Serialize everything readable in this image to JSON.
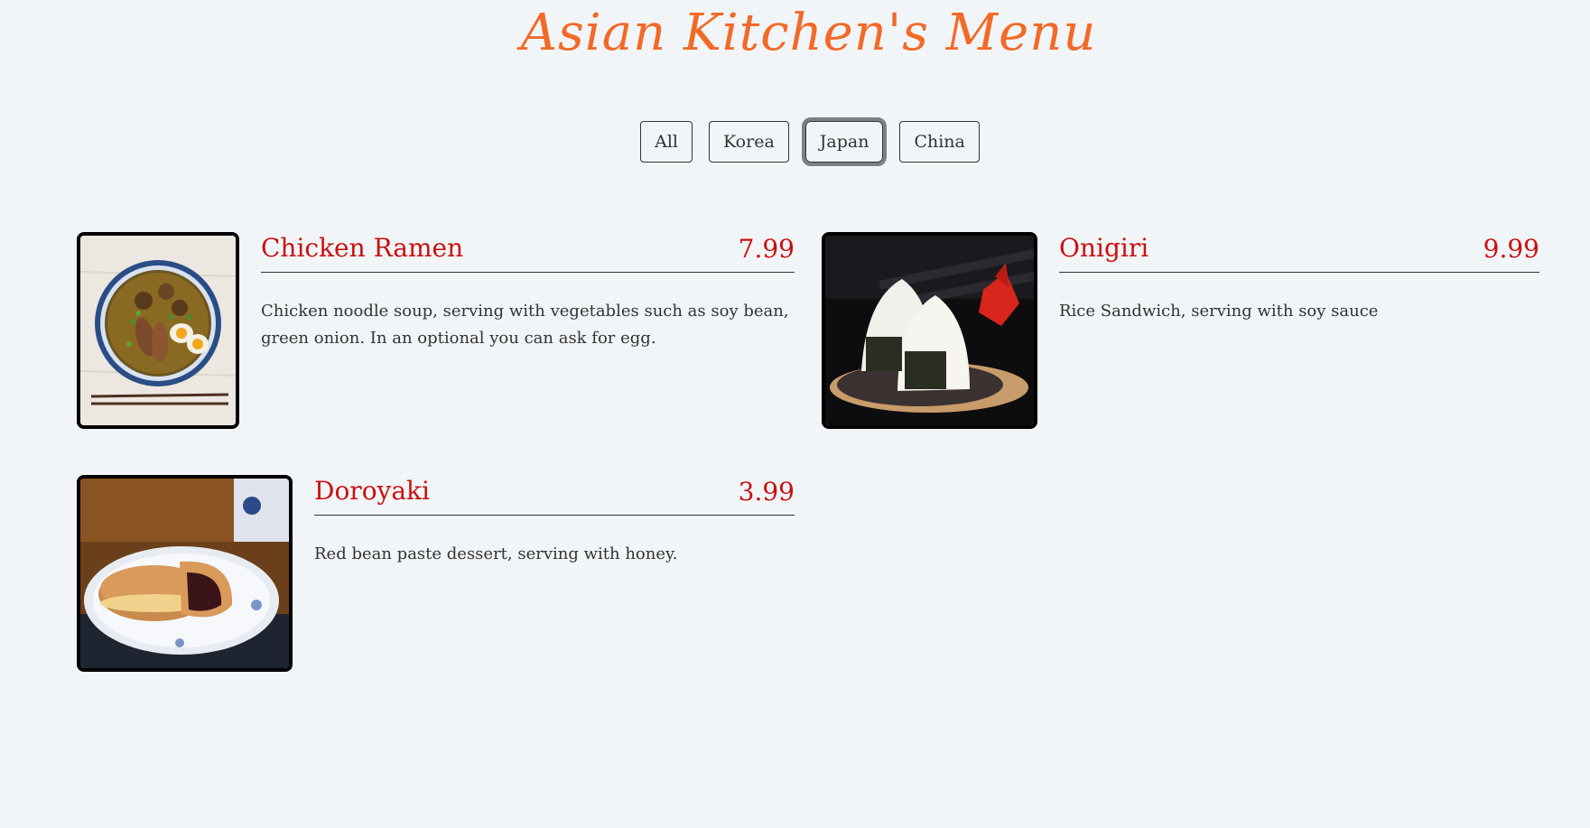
{
  "header": {
    "title": "Asian Kitchen's Menu"
  },
  "filters": [
    {
      "label": "All",
      "active": false
    },
    {
      "label": "Korea",
      "active": false
    },
    {
      "label": "Japan",
      "active": true
    },
    {
      "label": "China",
      "active": false
    }
  ],
  "menu": {
    "items": [
      {
        "name": "Chicken Ramen",
        "price": "7.99",
        "description": "Chicken noodle soup, serving with vegetables such as soy bean, green onion. In an optional you can ask for egg."
      },
      {
        "name": "Onigiri",
        "price": "9.99",
        "description": "Rice Sandwich, serving with soy sauce"
      },
      {
        "name": "Doroyaki",
        "price": "3.99",
        "description": "Red bean paste dessert, serving with honey."
      }
    ]
  },
  "colors": {
    "background": "#f1f5f8",
    "title": "#f26a28",
    "accent_red": "#c9100f",
    "text": "#333333"
  }
}
